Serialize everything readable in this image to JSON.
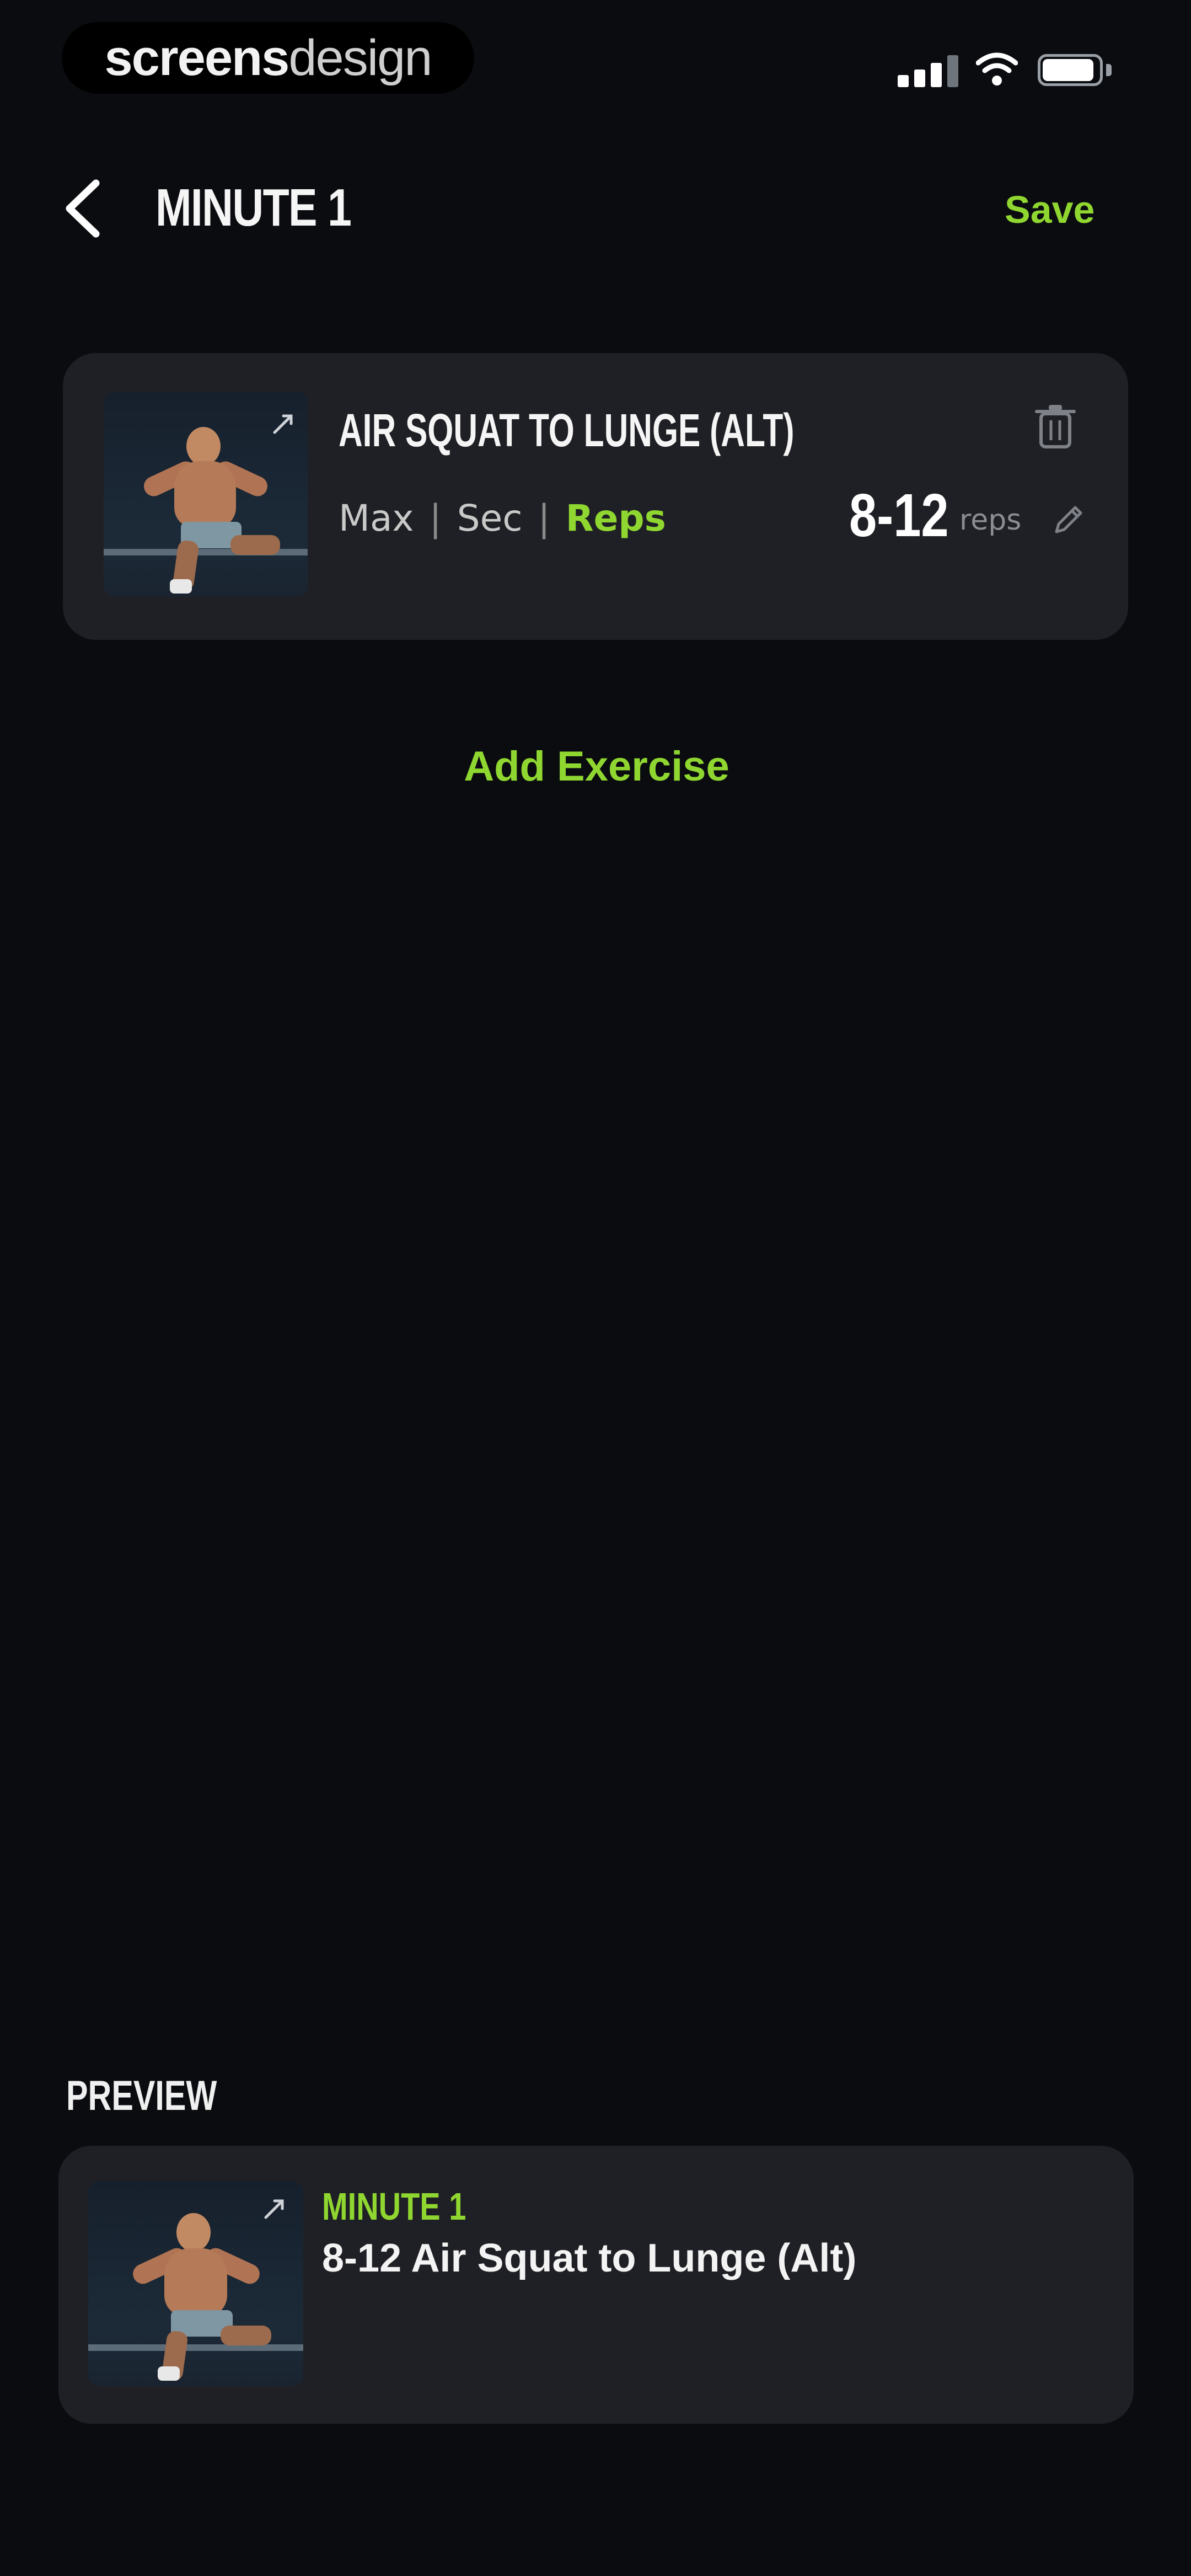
{
  "status_bar": {
    "watermark_bold": "screens",
    "watermark_light": "design",
    "icons": [
      "signal-icon",
      "wifi-icon",
      "battery-icon"
    ]
  },
  "header": {
    "title": "MINUTE 1",
    "save_label": "Save",
    "back_icon": "chevron-left-icon"
  },
  "exercise": {
    "name": "AIR SQUAT TO LUNGE (ALT)",
    "modes": [
      "Max",
      "Sec",
      "Reps"
    ],
    "active_mode": "Reps",
    "reps_value": "8-12",
    "reps_unit": "reps"
  },
  "add_exercise_label": "Add Exercise",
  "preview": {
    "label": "PREVIEW",
    "minute_label": "MINUTE 1",
    "exercise_text": "8-12 Air Squat to Lunge (Alt)"
  },
  "colors": {
    "background": "#0a0c10",
    "card": "#1f2025",
    "accent": "#8fd630",
    "text": "#ffffff",
    "muted": "#8a8d92"
  }
}
